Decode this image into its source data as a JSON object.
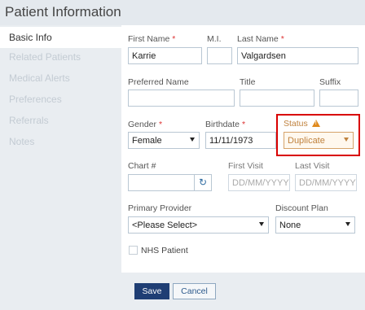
{
  "header": {
    "title": "Patient Information"
  },
  "sidebar": {
    "items": [
      {
        "label": "Basic Info"
      },
      {
        "label": "Related Patients"
      },
      {
        "label": "Medical Alerts"
      },
      {
        "label": "Preferences"
      },
      {
        "label": "Referrals"
      },
      {
        "label": "Notes"
      }
    ]
  },
  "form": {
    "first_name": {
      "label": "First Name",
      "value": "Karrie",
      "required": "*"
    },
    "mi": {
      "label": "M.I.",
      "value": ""
    },
    "last_name": {
      "label": "Last Name",
      "value": "Valgardsen",
      "required": "*"
    },
    "preferred_name": {
      "label": "Preferred Name",
      "value": ""
    },
    "title": {
      "label": "Title",
      "value": ""
    },
    "suffix": {
      "label": "Suffix",
      "value": ""
    },
    "gender": {
      "label": "Gender",
      "value": "Female",
      "required": "*"
    },
    "birthdate": {
      "label": "Birthdate",
      "value": "11/11/1973",
      "required": "*"
    },
    "status": {
      "label": "Status",
      "value": "Duplicate",
      "warning_glyph": "!"
    },
    "chart": {
      "label": "Chart #",
      "value": ""
    },
    "first_visit": {
      "label": "First Visit",
      "placeholder": "DD/MM/YYYY"
    },
    "last_visit": {
      "label": "Last Visit",
      "placeholder": "DD/MM/YYYY"
    },
    "primary_provider": {
      "label": "Primary Provider",
      "value": "<Please Select>"
    },
    "discount_plan": {
      "label": "Discount Plan",
      "value": "None"
    },
    "nhs_patient": {
      "label": "NHS Patient"
    }
  },
  "actions": {
    "save_label": "Save",
    "cancel_label": "Cancel"
  },
  "colors": {
    "highlight": "#d90000",
    "primary": "#1f3e74",
    "warning": "#e08a1e"
  },
  "icons": {
    "refresh": "refresh-icon",
    "warning": "warning-icon"
  }
}
